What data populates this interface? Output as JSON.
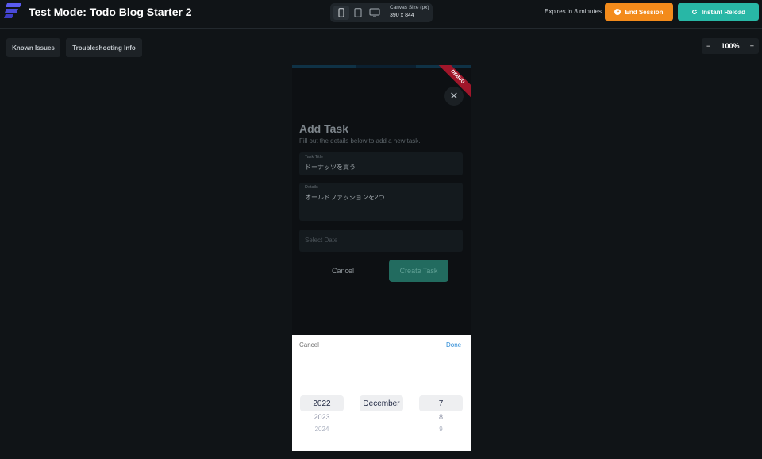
{
  "header": {
    "title": "Test Mode: Todo Blog Starter 2",
    "canvas_label": "Canvas Size (px)",
    "canvas_value": "390 x 844",
    "expires": "Expires in 8 minutes",
    "end_session": "End Session",
    "instant_reload": "Instant Reload",
    "devices": [
      "phone-icon",
      "tablet-icon",
      "desktop-icon"
    ]
  },
  "toolbar": {
    "known_issues": "Known Issues",
    "troubleshooting": "Troubleshooting Info",
    "zoom_minus": "−",
    "zoom_level": "100%",
    "zoom_plus": "+"
  },
  "phone": {
    "debug_banner": "DEBUG",
    "close": "✕",
    "heading": "Add Task",
    "subtitle": "Fill out the details below to add a new task.",
    "task_title_label": "Task Title",
    "task_title_value": "ドーナッツを買う",
    "details_label": "Details",
    "details_value": "オールドファッションを2つ",
    "date_placeholder": "Select Date",
    "cancel": "Cancel",
    "create": "Create Task"
  },
  "picker": {
    "cancel": "Cancel",
    "done": "Done",
    "year": "2022",
    "year_next": "2023",
    "year_next2": "2024",
    "month": "December",
    "day": "7",
    "day_next": "8",
    "day_next2": "9"
  },
  "colors": {
    "end_session": "#f38b1b",
    "instant_reload": "#28b7a6",
    "create_button": "#226b5f",
    "picker_done": "#2b8ad6",
    "debug_banner": "#a0162a"
  }
}
